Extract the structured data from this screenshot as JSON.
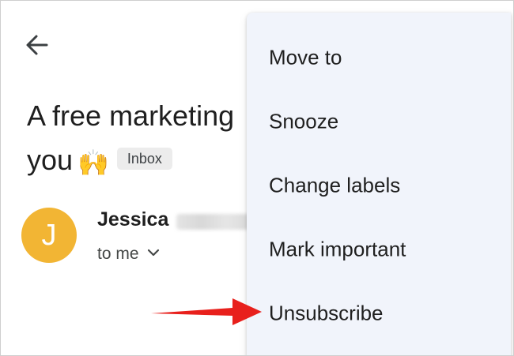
{
  "email": {
    "subject_line1": "A free marketing",
    "subject_line2": "you",
    "emoji": "🙌",
    "label_chip": "Inbox",
    "sender": {
      "avatar_initial": "J",
      "name": "Jessica",
      "recipient": "to me"
    }
  },
  "menu": {
    "items": [
      {
        "label": "Move to"
      },
      {
        "label": "Snooze"
      },
      {
        "label": "Change labels"
      },
      {
        "label": "Mark important"
      },
      {
        "label": "Unsubscribe"
      }
    ]
  },
  "colors": {
    "avatar": "#f2b534",
    "menu_background": "#f1f4fb",
    "annotation_arrow": "#e8201c",
    "chip_background": "#ececec"
  },
  "icons": {
    "back": "arrow-back-icon",
    "expand": "chevron-down-icon",
    "annotation": "red-pointer-arrow"
  }
}
